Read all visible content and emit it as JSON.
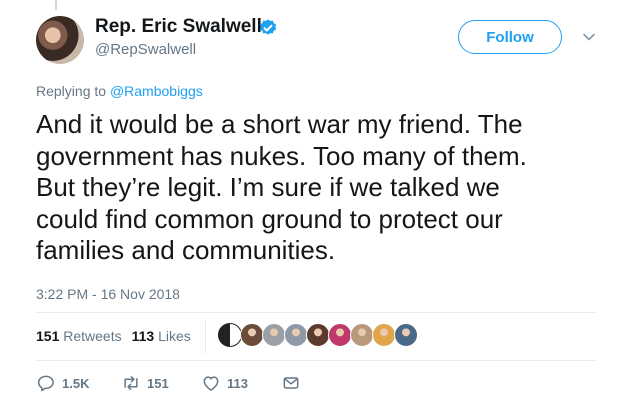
{
  "tweet": {
    "author_name": "Rep. Eric Swalwell",
    "author_handle": "@RepSwalwell",
    "follow_label": "Follow",
    "replying_prefix": "Replying to",
    "replying_to": "@Rambobiggs",
    "text": "And it would be a short war my friend. The\ngovernment has nukes. Too many of them.\nBut they’re legit. I’m sure if we talked we\ncould find common ground to protect our\nfamilies and communities.",
    "timestamp": "3:22 PM - 16 Nov 2018"
  },
  "stats": {
    "retweets_count": "151",
    "retweets_label": "Retweets",
    "likes_count": "113",
    "likes_label": "Likes"
  },
  "likers": [
    {
      "icon": "yin-yang-avatar",
      "color": "#222222"
    },
    {
      "icon": "person-avatar",
      "color": "#6b4b3a"
    },
    {
      "icon": "person-avatar",
      "color": "#9aa0a6"
    },
    {
      "icon": "person-avatar",
      "color": "#8d99a6"
    },
    {
      "icon": "person-avatar",
      "color": "#5a3b2e"
    },
    {
      "icon": "person-avatar",
      "color": "#c0396b"
    },
    {
      "icon": "person-avatar",
      "color": "#b89a7a"
    },
    {
      "icon": "person-avatar",
      "color": "#e2a64a"
    },
    {
      "icon": "person-avatar",
      "color": "#4a6a8a"
    }
  ],
  "actions": {
    "reply_count": "1.5K",
    "retweet_count": "151",
    "like_count": "113"
  },
  "colors": {
    "accent": "#1da1f2",
    "text": "#14171a",
    "secondary": "#657786"
  }
}
